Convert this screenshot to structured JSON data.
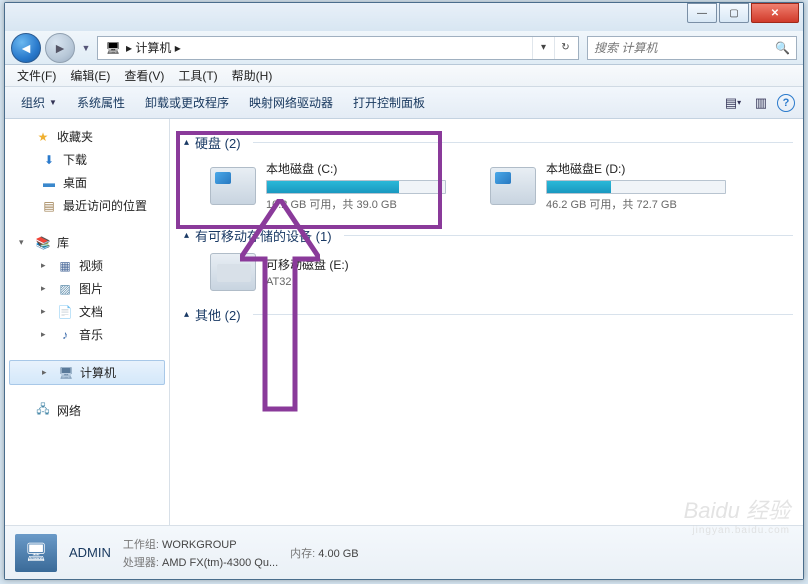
{
  "address": {
    "path": "▸ 计算机 ▸"
  },
  "search": {
    "placeholder": "搜索 计算机"
  },
  "menu": {
    "file": "文件(F)",
    "edit": "编辑(E)",
    "view": "查看(V)",
    "tools": "工具(T)",
    "help": "帮助(H)"
  },
  "toolbar": {
    "organize": "组织",
    "sysprops": "系统属性",
    "uninstall": "卸载或更改程序",
    "mapnet": "映射网络驱动器",
    "ctrlpanel": "打开控制面板"
  },
  "sidebar": {
    "favorites": "收藏夹",
    "downloads": "下载",
    "desktop": "桌面",
    "recent": "最近访问的位置",
    "libraries": "库",
    "videos": "视频",
    "pictures": "图片",
    "documents": "文档",
    "music": "音乐",
    "computer": "计算机",
    "network": "网络"
  },
  "categories": {
    "hdd": "硬盘 (2)",
    "removable": "有可移动存储的设备 (1)",
    "other": "其他 (2)"
  },
  "drives": {
    "c": {
      "name": "本地磁盘 (C:)",
      "text": "10.2 GB 可用，共 39.0 GB",
      "pct": 74
    },
    "d": {
      "name": "本地磁盘E (D:)",
      "text": "46.2 GB 可用，共 72.7 GB",
      "pct": 36
    },
    "e": {
      "name": "可移动磁盘 (E:)",
      "sub": "AT32"
    }
  },
  "details": {
    "name": "ADMIN",
    "workgroup_lbl": "工作组:",
    "workgroup": "WORKGROUP",
    "cpu_lbl": "处理器:",
    "cpu": "AMD FX(tm)-4300 Qu...",
    "mem_lbl": "内存:",
    "mem": "4.00 GB"
  },
  "watermark": {
    "brand": "Baidu 经验",
    "url": "jingyan.baidu.com"
  }
}
